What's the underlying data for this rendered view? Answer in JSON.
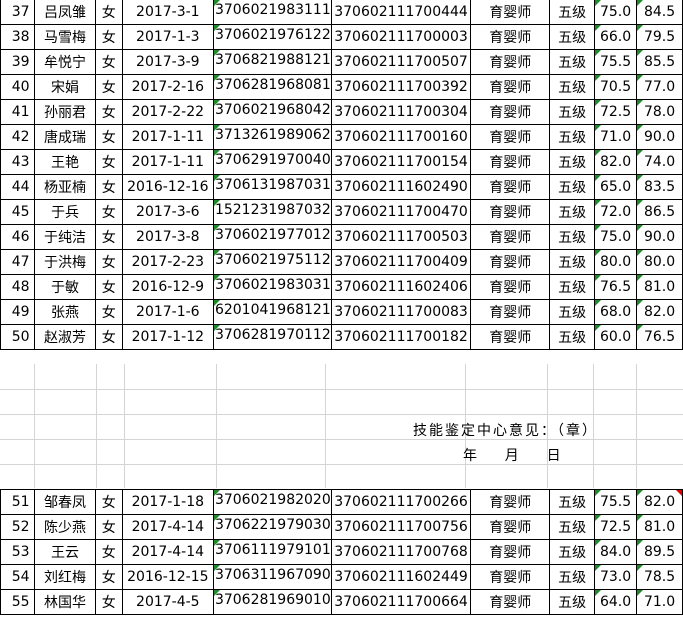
{
  "top_rows": [
    {
      "idx": "37",
      "name": "吕凤雏",
      "sex": "女",
      "date": "2017-3-1",
      "id": "3706021983111",
      "cert": "370602111700444",
      "job": "育婴师",
      "level": "五级",
      "s1": "75.0",
      "s2": "84.5"
    },
    {
      "idx": "38",
      "name": "马雪梅",
      "sex": "女",
      "date": "2017-1-3",
      "id": "3706021976122",
      "cert": "370602111700003",
      "job": "育婴师",
      "level": "五级",
      "s1": "66.0",
      "s2": "79.5"
    },
    {
      "idx": "39",
      "name": "牟悦宁",
      "sex": "女",
      "date": "2017-3-9",
      "id": "3706821988121",
      "cert": "370602111700507",
      "job": "育婴师",
      "level": "五级",
      "s1": "75.5",
      "s2": "85.5"
    },
    {
      "idx": "40",
      "name": "宋娟",
      "sex": "女",
      "date": "2017-2-16",
      "id": "3706281968081",
      "cert": "370602111700392",
      "job": "育婴师",
      "level": "五级",
      "s1": "70.5",
      "s2": "77.0"
    },
    {
      "idx": "41",
      "name": "孙丽君",
      "sex": "女",
      "date": "2017-2-22",
      "id": "3706021968042",
      "cert": "370602111700304",
      "job": "育婴师",
      "level": "五级",
      "s1": "72.5",
      "s2": "78.0"
    },
    {
      "idx": "42",
      "name": "唐成瑞",
      "sex": "女",
      "date": "2017-1-11",
      "id": "3713261989062",
      "cert": "370602111700160",
      "job": "育婴师",
      "level": "五级",
      "s1": "71.0",
      "s2": "90.0"
    },
    {
      "idx": "43",
      "name": "王艳",
      "sex": "女",
      "date": "2017-1-11",
      "id": "3706291970040",
      "cert": "370602111700154",
      "job": "育婴师",
      "level": "五级",
      "s1": "82.0",
      "s2": "74.0"
    },
    {
      "idx": "44",
      "name": "杨亚楠",
      "sex": "女",
      "date": "2016-12-16",
      "id": "3706131987031",
      "cert": "370602111602490",
      "job": "育婴师",
      "level": "五级",
      "s1": "65.0",
      "s2": "83.5"
    },
    {
      "idx": "45",
      "name": "于兵",
      "sex": "女",
      "date": "2017-3-6",
      "id": "1521231987032",
      "cert": "370602111700470",
      "job": "育婴师",
      "level": "五级",
      "s1": "72.0",
      "s2": "86.5"
    },
    {
      "idx": "46",
      "name": "于纯洁",
      "sex": "女",
      "date": "2017-3-8",
      "id": "3706021977012",
      "cert": "370602111700503",
      "job": "育婴师",
      "level": "五级",
      "s1": "75.0",
      "s2": "90.0"
    },
    {
      "idx": "47",
      "name": "于洪梅",
      "sex": "女",
      "date": "2017-2-23",
      "id": "3706021975112",
      "cert": "370602111700409",
      "job": "育婴师",
      "level": "五级",
      "s1": "80.0",
      "s2": "80.0"
    },
    {
      "idx": "48",
      "name": "于敏",
      "sex": "女",
      "date": "2016-12-9",
      "id": "3706021983031",
      "cert": "370602111602406",
      "job": "育婴师",
      "level": "五级",
      "s1": "76.5",
      "s2": "81.0"
    },
    {
      "idx": "49",
      "name": "张燕",
      "sex": "女",
      "date": "2017-1-6",
      "id": "6201041968121",
      "cert": "370602111700083",
      "job": "育婴师",
      "level": "五级",
      "s1": "68.0",
      "s2": "82.0"
    },
    {
      "idx": "50",
      "name": "赵淑芳",
      "sex": "女",
      "date": "2017-1-12",
      "id": "3706281970112",
      "cert": "370602111700182",
      "job": "育婴师",
      "level": "五级",
      "s1": "60.0",
      "s2": "76.5"
    }
  ],
  "footer_note": {
    "opinion": "技能鉴定中心意见：（章）",
    "date_line": "年    月    日"
  },
  "bottom_rows": [
    {
      "idx": "51",
      "name": "邹春凤",
      "sex": "女",
      "date": "2017-1-18",
      "id": "3706021982020",
      "cert": "370602111700266",
      "job": "育婴师",
      "level": "五级",
      "s1": "75.5",
      "s2": "82.0"
    },
    {
      "idx": "52",
      "name": "陈少燕",
      "sex": "女",
      "date": "2017-4-14",
      "id": "3706221979030",
      "cert": "370602111700756",
      "job": "育婴师",
      "level": "五级",
      "s1": "72.5",
      "s2": "81.0"
    },
    {
      "idx": "53",
      "name": "王云",
      "sex": "女",
      "date": "2017-4-14",
      "id": "3706111979101",
      "cert": "370602111700768",
      "job": "育婴师",
      "level": "五级",
      "s1": "84.0",
      "s2": "89.5"
    },
    {
      "idx": "54",
      "name": "刘红梅",
      "sex": "女",
      "date": "2016-12-15",
      "id": "3706311967090",
      "cert": "370602111602449",
      "job": "育婴师",
      "level": "五级",
      "s1": "73.0",
      "s2": "78.5"
    },
    {
      "idx": "55",
      "name": "林国华",
      "sex": "女",
      "date": "2017-4-5",
      "id": "3706281969010",
      "cert": "370602111700664",
      "job": "育婴师",
      "level": "五级",
      "s1": "64.0",
      "s2": "71.0"
    }
  ],
  "colors": {
    "grid": "#000000",
    "light_grid": "#d4d4d4",
    "number_marker": "#1f8a2a",
    "comment_marker": "#e00000"
  }
}
